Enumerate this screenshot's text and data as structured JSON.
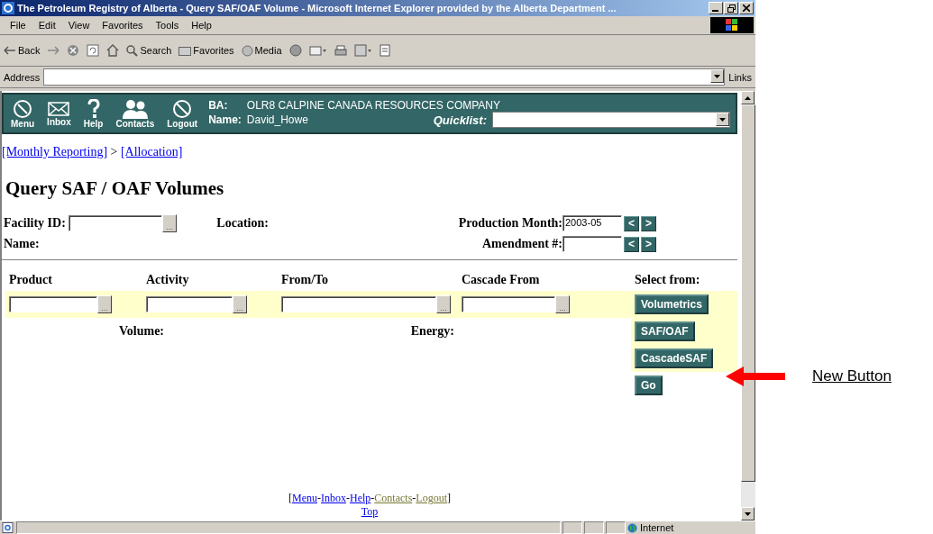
{
  "window": {
    "title": "The Petroleum Registry of Alberta - Query SAF/OAF Volume - Microsoft Internet Explorer provided by the Alberta Department ..."
  },
  "menu_bar": [
    "File",
    "Edit",
    "View",
    "Favorites",
    "Tools",
    "Help"
  ],
  "toolbar": {
    "back": "Back",
    "search": "Search",
    "favorites": "Favorites",
    "media": "Media"
  },
  "address_bar": {
    "label": "Address",
    "links": "Links"
  },
  "header": {
    "nav": [
      {
        "kind": "menu",
        "label": "Menu"
      },
      {
        "kind": "inbox",
        "label": "Inbox"
      },
      {
        "kind": "help",
        "label": "Help"
      },
      {
        "kind": "contacts",
        "label": "Contacts"
      },
      {
        "kind": "logout",
        "label": "Logout"
      }
    ],
    "ba_label": "BA:",
    "ba_value": "OLR8 CALPINE CANADA RESOURCES COMPANY",
    "name_label": "Name:",
    "name_value": "David_Howe",
    "quicklist_label": "Quicklist:"
  },
  "breadcrumb": [
    {
      "kind": "link",
      "text": "[Monthly Reporting]"
    },
    {
      "kind": "sep",
      "text": ">"
    },
    {
      "kind": "link",
      "text": "[Allocation]"
    }
  ],
  "heading": "Query SAF / OAF Volumes",
  "criteria": {
    "facility_id": "Facility ID:",
    "location": "Location:",
    "production_month": "Production Month:",
    "production_month_value": "2003-05",
    "name": "Name:",
    "amendment": "Amendment #:",
    "prev": "<",
    "next": ">",
    "browse": "..."
  },
  "columns": [
    "Product",
    "Activity",
    "From/To",
    "Cascade From",
    "Select from:"
  ],
  "select_buttons": [
    "Volumetrics",
    "SAF/OAF",
    "CascadeSAF",
    "Go"
  ],
  "results": {
    "volume": "Volume:",
    "energy": "Energy:"
  },
  "footer": {
    "open": "[",
    "close": "]",
    "sep": "-",
    "links": [
      {
        "text": "Menu",
        "visited": false
      },
      {
        "text": "Inbox",
        "visited": false
      },
      {
        "text": "Help",
        "visited": false
      },
      {
        "text": "Contacts",
        "visited": true
      },
      {
        "text": "Logout",
        "visited": true
      }
    ],
    "top": "Top"
  },
  "status_bar": {
    "zone": "Internet"
  },
  "annotation": {
    "text": "New Button"
  }
}
